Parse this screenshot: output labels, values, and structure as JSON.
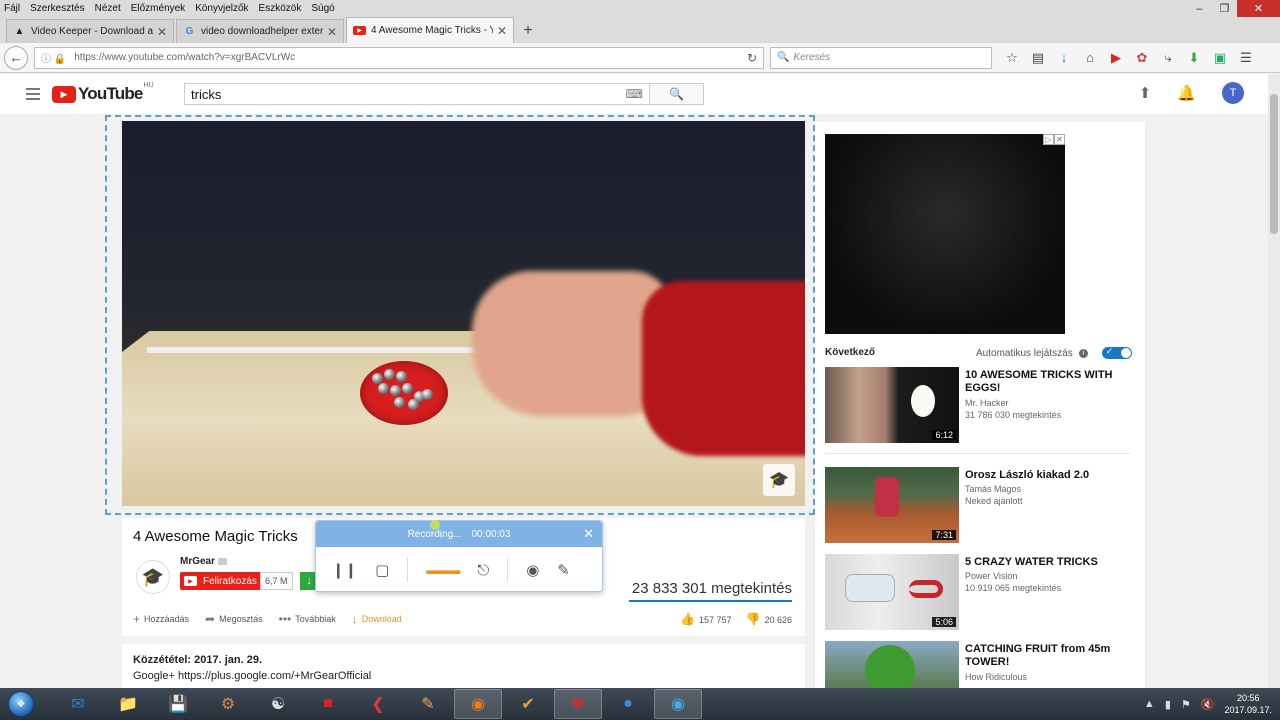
{
  "menubar": {
    "items": [
      "Fájl",
      "Szerkesztés",
      "Nézet",
      "Előzmények",
      "Könyvjelzők",
      "Eszközök",
      "Súgó"
    ]
  },
  "tabs": [
    {
      "title": "Video Keeper - Download ar",
      "icon": "video-keeper-icon"
    },
    {
      "title": "video downloadhelper exter",
      "icon": "google-icon"
    },
    {
      "title": "4 Awesome Magic Tricks - Y",
      "icon": "youtube-icon"
    }
  ],
  "navbar": {
    "url": "https://www.youtube.com/watch?v=xgrBACVLrWc",
    "search_placeholder": "Keresés"
  },
  "youtube": {
    "logo_text": "YouTube",
    "region": "HU",
    "search_value": "tricks",
    "avatar_letter": "T"
  },
  "video": {
    "title": "4 Awesome Magic Tricks",
    "channel": "MrGear",
    "subscribe_label": "Feliratkozás",
    "subscriber_count": "6,7 M",
    "views": "23 833 301 megtekintés",
    "actions": {
      "add": "Hozzáadás",
      "share": "Megosztás",
      "more": "Továbbiak",
      "download": "Download"
    },
    "likes": "157 757",
    "dislikes": "20 626",
    "published": "Közzététel: 2017. jan. 29.",
    "description_line": "Google+ https://plus.google.com/+MrGearOfficial"
  },
  "recorder": {
    "status": "Recording...",
    "time": "00:00:03"
  },
  "sidebar": {
    "next_label": "Következő",
    "autoplay_label": "Automatikus lejátszás",
    "videos": [
      {
        "title": "10 AWESOME TRICKS WITH EGGS!",
        "channel": "Mr. Hacker",
        "meta": "31 786 030 megtekintés",
        "duration": "6:12"
      },
      {
        "title": "Orosz László kiakad 2.0",
        "channel": "Tamás Magos",
        "meta": "Neked ajánlott",
        "duration": "7:31"
      },
      {
        "title": "5 CRAZY WATER TRICKS",
        "channel": "Power Vision",
        "meta": "10 919 065 megtekintés",
        "duration": "5:06"
      },
      {
        "title": "CATCHING FRUIT from 45m TOWER!",
        "channel": "How Ridiculous",
        "meta": "",
        "duration": ""
      }
    ]
  },
  "taskbar": {
    "time": "20:56",
    "date": "2017.09.17."
  }
}
